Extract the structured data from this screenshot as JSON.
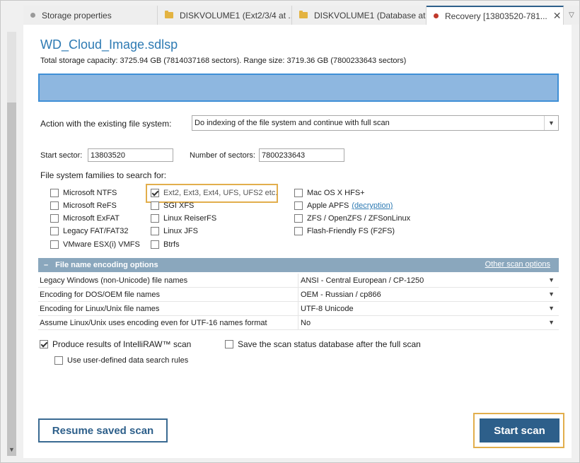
{
  "tabs": [
    {
      "label": "Storage properties",
      "icon": "dot-icon"
    },
    {
      "label": "DISKVOLUME1 (Ext2/3/4 at ...",
      "icon": "folder-icon"
    },
    {
      "label": "DISKVOLUME1 (Database at...",
      "icon": "folder-icon"
    },
    {
      "label": "Recovery [13803520-781...",
      "icon": "recovery-dot-icon",
      "close": "✕"
    }
  ],
  "tab_menu_icon": "▽",
  "title": "WD_Cloud_Image.sdlsp",
  "capacity": "Total storage capacity: 3725.94 GB (7814037168 sectors). Range size: 3719.36 GB (7800233643 sectors)",
  "action": {
    "label": "Action with the existing file system:",
    "value": "Do indexing of the file system and continue with full scan",
    "arrow": "▼"
  },
  "sectors": {
    "start_label": "Start sector:",
    "start_value": "13803520",
    "count_label": "Number of sectors:",
    "count_value": "7800233643"
  },
  "families": {
    "label": "File system families to search for:",
    "col1": [
      {
        "label": "Microsoft NTFS",
        "checked": false
      },
      {
        "label": "Microsoft ReFS",
        "checked": false
      },
      {
        "label": "Microsoft ExFAT",
        "checked": false
      },
      {
        "label": "Legacy FAT/FAT32",
        "checked": false
      },
      {
        "label": "VMware ESX(i) VMFS",
        "checked": false
      }
    ],
    "col2": [
      {
        "label": "Ext2, Ext3, Ext4, UFS, UFS2 etc.",
        "checked": true
      },
      {
        "label": "SGI XFS",
        "checked": false
      },
      {
        "label": "Linux ReiserFS",
        "checked": false
      },
      {
        "label": "Linux JFS",
        "checked": false
      },
      {
        "label": "Btrfs",
        "checked": false
      }
    ],
    "col3": [
      {
        "label": "Mac OS X HFS+",
        "checked": false
      },
      {
        "label": "Apple APFS",
        "checked": false,
        "link": "(decryption)"
      },
      {
        "label": "ZFS / OpenZFS / ZFSonLinux",
        "checked": false
      },
      {
        "label": "Flash-Friendly FS (F2FS)",
        "checked": false
      }
    ]
  },
  "encoding": {
    "header": "File name encoding options",
    "collapse": "–",
    "other_link": "Other scan options",
    "rows": [
      {
        "key": "Legacy Windows (non-Unicode) file names",
        "value": "ANSI - Central European / CP-1250"
      },
      {
        "key": "Encoding for DOS/OEM file names",
        "value": "OEM - Russian / cp866"
      },
      {
        "key": "Encoding for Linux/Unix file names",
        "value": "UTF-8 Unicode"
      },
      {
        "key": "Assume Linux/Unix uses encoding even for UTF-16 names format",
        "value": "No"
      }
    ],
    "dd_arrow": "▼"
  },
  "options": {
    "intelliraw": {
      "label": "Produce results of IntelliRAW™ scan",
      "checked": true
    },
    "save_db": {
      "label": "Save the scan status database after the full scan",
      "checked": false
    },
    "user_rules": {
      "label": "Use user-defined data search rules",
      "checked": false
    }
  },
  "buttons": {
    "resume": "Resume saved scan",
    "start": "Start scan"
  },
  "scroll_arrow": "▼",
  "colors": {
    "accent": "#2d5f8a",
    "title": "#2d7ab3",
    "highlight": "#e2ae4c",
    "mapbar": "#8eb7e0",
    "section_header": "#8aa7bd"
  }
}
